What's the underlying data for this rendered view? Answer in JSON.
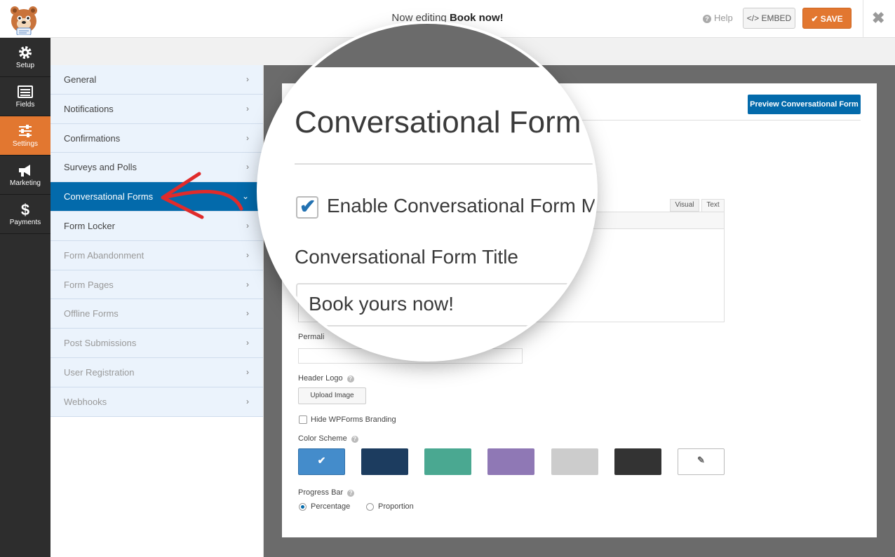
{
  "header": {
    "editing_prefix": "Now editing",
    "form_name": "Book now!",
    "help_label": "Help",
    "embed_label": "EMBED",
    "save_label": "SAVE",
    "close_glyph": "✖"
  },
  "iconbar": {
    "items": [
      {
        "label": "Setup",
        "icon": "gear-icon"
      },
      {
        "label": "Fields",
        "icon": "fields-icon"
      },
      {
        "label": "Settings",
        "icon": "sliders-icon",
        "active": true
      },
      {
        "label": "Marketing",
        "icon": "megaphone-icon"
      },
      {
        "label": "Payments",
        "icon": "dollar-icon"
      }
    ]
  },
  "settings_panel": {
    "items": [
      {
        "label": "General"
      },
      {
        "label": "Notifications"
      },
      {
        "label": "Confirmations"
      },
      {
        "label": "Surveys and Polls"
      },
      {
        "label": "Conversational Forms",
        "active": true
      },
      {
        "label": "Form Locker"
      },
      {
        "label": "Form Abandonment"
      },
      {
        "label": "Form Pages"
      },
      {
        "label": "Offline Forms"
      },
      {
        "label": "Post Submissions"
      },
      {
        "label": "User Registration"
      },
      {
        "label": "Webhooks"
      }
    ]
  },
  "content": {
    "preview_button": "Preview Conversational Form",
    "editor_tab_visual": "Visual",
    "editor_tab_text": "Text",
    "permalink_label": "Permali",
    "header_logo_label": "Header Logo",
    "upload_image_label": "Upload Image",
    "hide_branding_label": "Hide WPForms Branding",
    "color_scheme_label": "Color Scheme",
    "color_swatches": [
      "#448ccb",
      "#1c3c5f",
      "#4aa891",
      "#8f78b5",
      "#cccccc",
      "#333333"
    ],
    "selected_swatch_check": "✔",
    "picker_glyph": "✎",
    "progress_bar_label": "Progress Bar",
    "progress_options": [
      "Percentage",
      "Proportion"
    ],
    "progress_selected": "Percentage"
  },
  "magnifier": {
    "section_title": "Conversational Form",
    "enable_label": "Enable Conversational Form M",
    "enable_checked": true,
    "field_title_label": "Conversational Form Title",
    "field_title_value": "Book yours now!"
  },
  "colors": {
    "accent_orange": "#e27730",
    "accent_blue": "#036aab",
    "sidebar_dark": "#2d2d2d",
    "arrow_red": "#e02b2b"
  }
}
